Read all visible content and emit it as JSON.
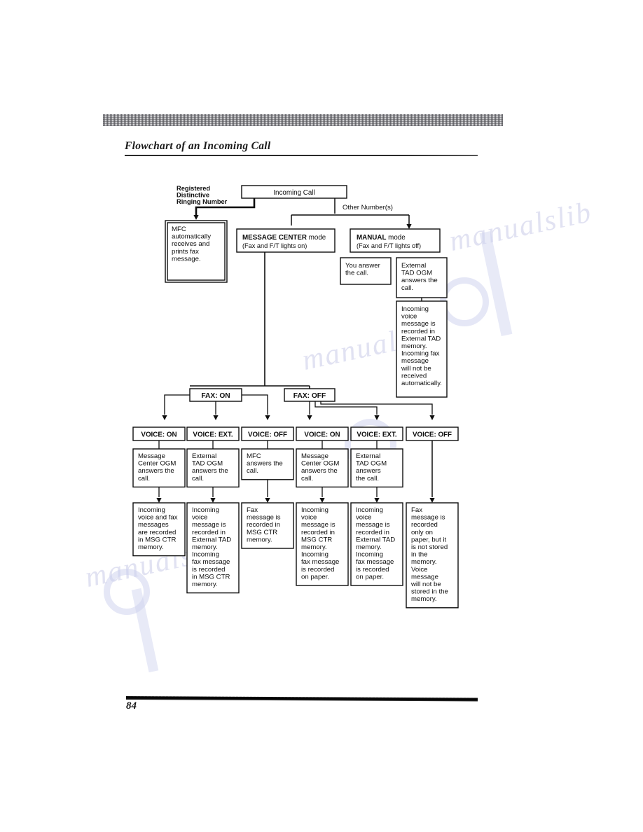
{
  "document": {
    "section_title": "Flowchart of an Incoming Call",
    "page_number": "84",
    "watermark_text": "manualslib"
  },
  "flowchart": {
    "title": "Flowchart of an Incoming Call",
    "labels": {
      "registered_distinctive": [
        "Registered",
        "Distinctive",
        "Ringing Number"
      ],
      "other_numbers": "Other Number(s)"
    },
    "nodes": {
      "incoming_call": {
        "text": "Incoming Call"
      },
      "mfc_auto": {
        "lines": [
          "MFC",
          "automatically",
          "receives and",
          "prints fax",
          "message."
        ]
      },
      "message_center": {
        "bold": "MESSAGE CENTER",
        "rest": " mode",
        "sub": "(Fax and F/T lights on)"
      },
      "manual": {
        "bold": "MANUAL",
        "rest": " mode",
        "sub": "(Fax and F/T lights off)"
      },
      "you_answer": {
        "lines": [
          "You answer",
          "the call."
        ]
      },
      "ext_tad_ogm_manual": {
        "lines": [
          "External",
          "TAD OGM",
          "answers the",
          "call."
        ]
      },
      "manual_result": {
        "lines": [
          "Incoming",
          "voice",
          "message is",
          "recorded in",
          "External TAD",
          "memory.",
          "Incoming fax",
          "message",
          "will not be",
          "received",
          "automatically."
        ]
      },
      "fax_on": {
        "text": "FAX: ON"
      },
      "fax_off": {
        "text": "FAX: OFF"
      }
    },
    "columns": [
      {
        "voice": "VOICE: ON",
        "answer": [
          "Message",
          "Center OGM",
          "answers the",
          "call."
        ],
        "result": [
          "Incoming",
          "voice and fax",
          "messages",
          "are recorded",
          "in MSG CTR",
          "memory."
        ]
      },
      {
        "voice": "VOICE: EXT.",
        "answer": [
          "External",
          "TAD OGM",
          "answers the",
          "call."
        ],
        "result": [
          "Incoming",
          "voice",
          "message is",
          "recorded in",
          "External TAD",
          "memory.",
          "Incoming",
          "fax message",
          "is recorded",
          "in MSG CTR",
          "memory."
        ]
      },
      {
        "voice": "VOICE: OFF",
        "answer": [
          "MFC",
          "answers the",
          "call."
        ],
        "result": [
          "Fax",
          "message is",
          "recorded in",
          "MSG CTR",
          "memory."
        ]
      },
      {
        "voice": "VOICE: ON",
        "answer": [
          "Message",
          "Center OGM",
          "answers the",
          "call."
        ],
        "result": [
          "Incoming",
          "voice",
          "message is",
          "recorded in",
          "MSG CTR",
          "memory.",
          "Incoming",
          "fax message",
          "is recorded",
          "on paper."
        ]
      },
      {
        "voice": "VOICE: EXT.",
        "answer": [
          "External",
          "TAD OGM",
          "answers",
          "the call."
        ],
        "result": [
          "Incoming",
          "voice",
          "message is",
          "recorded in",
          "External TAD",
          "memory.",
          "Incoming",
          "fax message",
          "is recorded",
          "on paper."
        ]
      },
      {
        "voice": "VOICE: OFF",
        "answer": null,
        "result": [
          "Fax",
          "message is",
          "recorded",
          "only on",
          "paper, but it",
          "is not stored",
          "in the",
          "memory.",
          "Voice",
          "message",
          "will not be",
          "stored in the",
          "memory."
        ]
      }
    ]
  }
}
